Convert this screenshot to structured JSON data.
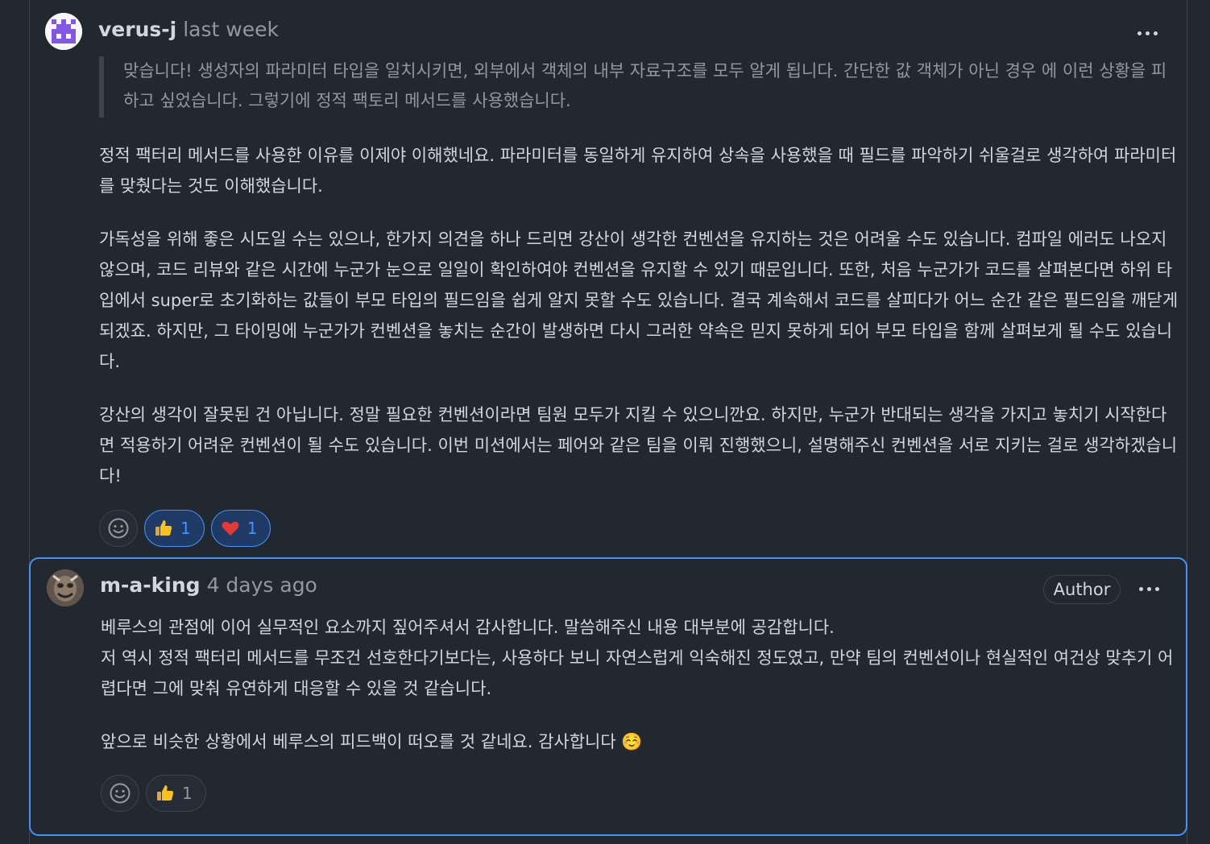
{
  "comments": [
    {
      "author": "verus-j",
      "time": "last week",
      "quote": "맞습니다! 생성자의 파라미터 타입을 일치시키면, 외부에서 객체의 내부 자료구조를 모두 알게 됩니다. 간단한 값 객체가 아닌 경우 에 이런 상황을 피하고 싶었습니다. 그렇기에 정적 팩토리 메서드를 사용했습니다.",
      "paragraphs": [
        "정적 팩터리 메서드를 사용한 이유를 이제야 이해했네요. 파라미터를 동일하게 유지하여 상속을 사용했을 때 필드를 파악하기 쉬울걸로 생각하여 파라미터를 맞췄다는 것도 이해했습니다.",
        "가독성을 위해 좋은 시도일 수는 있으나, 한가지 의견을 하나 드리면 강산이 생각한 컨벤션을 유지하는 것은 어려울 수도 있습니다. 컴파일 에러도 나오지 않으며, 코드 리뷰와 같은 시간에 누군가 눈으로 일일이 확인하여야 컨벤션을 유지할 수 있기 때문입니다. 또한, 처음 누군가가 코드를 살펴본다면 하위 타입에서 super로 초기화하는 값들이 부모 타입의 필드임을 쉽게 알지 못할 수도 있습니다. 결국 계속해서 코드를 살피다가 어느 순간 같은 필드임을 깨닫게 되겠죠. 하지만, 그 타이밍에 누군가가 컨벤션을 놓치는 순간이 발생하면 다시 그러한 약속은 믿지 못하게 되어 부모 타입을 함께 살펴보게 될 수도 있습니다.",
        "강산의 생각이 잘못된 건 아닙니다. 정말 필요한 컨벤션이라면 팀원 모두가 지킬 수 있으니깐요. 하지만, 누군가 반대되는 생각을 가지고 놓치기 시작한다면 적용하기 어려운 컨벤션이 될 수도 있습니다. 이번 미션에서는 페어와 같은 팀을 이뤄 진행했으니, 설명해주신 컨벤션을 서로 지키는 걸로 생각하겠습니다!"
      ],
      "reactions": [
        {
          "icon": "thumbs-up",
          "count": "1",
          "active": true
        },
        {
          "icon": "heart",
          "count": "1",
          "active": true
        }
      ]
    },
    {
      "author": "m-a-king",
      "time": "4 days ago",
      "badge": "Author",
      "paragraphs": [
        "베루스의 관점에 이어 실무적인 요소까지 짚어주셔서 감사합니다. 말씀해주신 내용 대부분에 공감합니다.",
        "저 역시 정적 팩터리 메서드를 무조건 선호한다기보다는, 사용하다 보니 자연스럽게 익숙해진 정도였고, 만약 팀의 컨벤션이나 현실적인 여건상 맞추기 어렵다면 그에 맞춰 유연하게 대응할 수 있을 것 같습니다.",
        "앞으로 비슷한 상황에서 베루스의 피드백이 떠오를 것 같네요. 감사합니다 ☺️"
      ],
      "reactions": [
        {
          "icon": "thumbs-up",
          "count": "1",
          "active": false
        }
      ]
    }
  ],
  "colors": {
    "background": "#212830",
    "border": "#3d444d",
    "accent": "#4493f8",
    "muted_text": "#9198a1",
    "text": "#d1d7e0"
  }
}
